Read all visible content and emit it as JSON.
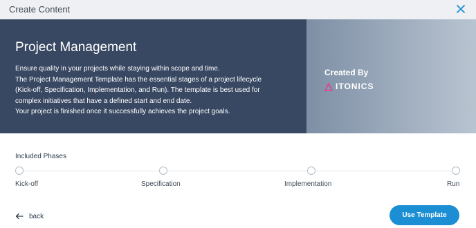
{
  "dialog": {
    "title": "Create Content",
    "close_icon": "close-icon"
  },
  "template": {
    "title": "Project Management",
    "description": [
      "Ensure quality in your projects while staying within scope and time.",
      "The Project Management Template has the essential stages of a project lifecycle",
      "(Kick-off, Specification, Implementation, and Run). The template is best used for",
      "complex initiatives that have a defined start and end date.",
      "Your project is finished once it successfully achieves the project goals."
    ]
  },
  "creator": {
    "label": "Created By",
    "brand": "ITONICS",
    "logo_color": "#e0428b"
  },
  "phases": {
    "label": "Included Phases",
    "items": [
      {
        "label": "Kick-off"
      },
      {
        "label": "Specification"
      },
      {
        "label": "Implementation"
      },
      {
        "label": "Run"
      }
    ]
  },
  "actions": {
    "back_label": "back",
    "use_template_label": "Use Template"
  },
  "colors": {
    "accent": "#1b8ed4",
    "hero_background": "#384862"
  }
}
